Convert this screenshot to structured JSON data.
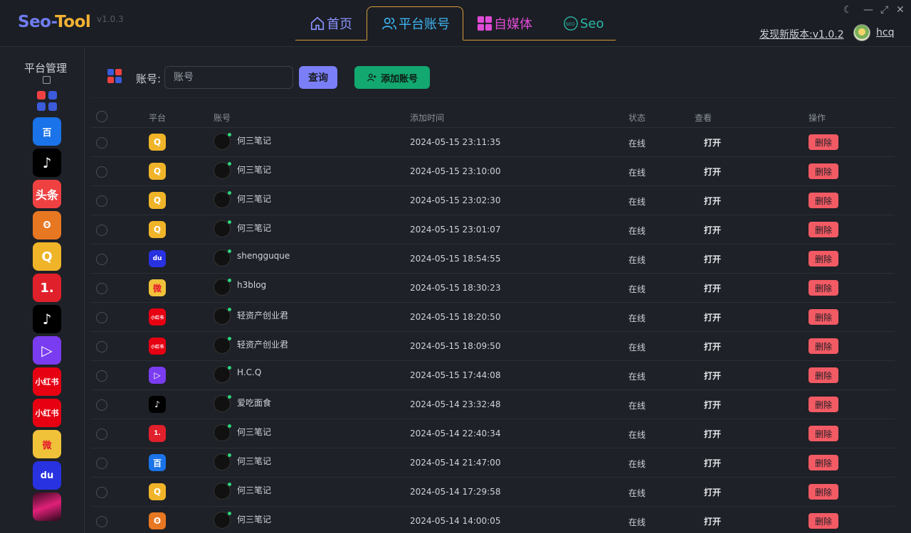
{
  "app": {
    "logo_prefix": "Seo",
    "logo_dash": "-",
    "logo_suffix": "Tool",
    "version": "v1.0.3",
    "update_text": "发现新版本:v1.0.2",
    "username": "hcq"
  },
  "nav": {
    "tabs": [
      {
        "label": "首页",
        "icon": "home-icon"
      },
      {
        "label": "平台账号",
        "icon": "users-icon"
      },
      {
        "label": "自媒体",
        "icon": "media-icon"
      },
      {
        "label": "Seo",
        "icon": "seo-icon"
      }
    ],
    "active": "平台账号"
  },
  "sidebar": {
    "title": "平台管理",
    "platforms": [
      {
        "name": "all",
        "color": "#3b5bdb"
      },
      {
        "name": "baijiahao",
        "color": "#1a73e8",
        "glyph": "百"
      },
      {
        "name": "douyin",
        "color": "#000000",
        "glyph": "♪"
      },
      {
        "name": "toutiao",
        "color": "#f04142",
        "glyph": "头条"
      },
      {
        "name": "sohu",
        "color": "#e87722",
        "glyph": "ʘ"
      },
      {
        "name": "qq",
        "color": "#f0b429",
        "glyph": "Q"
      },
      {
        "name": "yidian",
        "color": "#e0202b",
        "glyph": "1."
      },
      {
        "name": "douyin2",
        "color": "#000000",
        "glyph": "♪"
      },
      {
        "name": "xigua",
        "color": "#7a3cf0",
        "glyph": "▷"
      },
      {
        "name": "xiaohongshu",
        "color": "#e60012",
        "glyph": "小红书"
      },
      {
        "name": "xiaohongshu2",
        "color": "#e60012",
        "glyph": "小红书"
      },
      {
        "name": "weibo",
        "color": "#f0c23a",
        "glyph": "微"
      },
      {
        "name": "baidu",
        "color": "#2932e1",
        "glyph": "du"
      },
      {
        "name": "other",
        "color": "#c2185b",
        "glyph": ""
      }
    ]
  },
  "toolbar": {
    "account_label": "账号:",
    "account_placeholder": "账号",
    "query_label": "查询",
    "add_label": "添加账号"
  },
  "table": {
    "headers": {
      "platform": "平台",
      "account": "账号",
      "added_time": "添加时间",
      "status": "状态",
      "view": "查看",
      "action": "操作"
    },
    "open_label": "打开",
    "delete_label": "删除",
    "rows": [
      {
        "platform": "qq",
        "platform_color": "#f0b429",
        "glyph": "Q",
        "account": "何三笔记",
        "time": "2024-05-15 23:11:35",
        "status": "在线"
      },
      {
        "platform": "qq",
        "platform_color": "#f0b429",
        "glyph": "Q",
        "account": "何三笔记",
        "time": "2024-05-15 23:10:00",
        "status": "在线"
      },
      {
        "platform": "qq",
        "platform_color": "#f0b429",
        "glyph": "Q",
        "account": "何三笔记",
        "time": "2024-05-15 23:02:30",
        "status": "在线"
      },
      {
        "platform": "qq",
        "platform_color": "#f0b429",
        "glyph": "Q",
        "account": "何三笔记",
        "time": "2024-05-15 23:01:07",
        "status": "在线"
      },
      {
        "platform": "baidu",
        "platform_color": "#2932e1",
        "glyph": "du",
        "account": "shengguque",
        "time": "2024-05-15 18:54:55",
        "status": "在线"
      },
      {
        "platform": "weibo",
        "platform_color": "#f0c23a",
        "glyph": "微",
        "account": "h3blog",
        "time": "2024-05-15 18:30:23",
        "status": "在线"
      },
      {
        "platform": "xiaohongshu",
        "platform_color": "#e60012",
        "glyph": "小红书",
        "account": "轻资产创业君",
        "time": "2024-05-15 18:20:50",
        "status": "在线"
      },
      {
        "platform": "xiaohongshu",
        "platform_color": "#e60012",
        "glyph": "小红书",
        "account": "轻资产创业君",
        "time": "2024-05-15 18:09:50",
        "status": "在线"
      },
      {
        "platform": "xigua",
        "platform_color": "#7a3cf0",
        "glyph": "▷",
        "account": "H.C.Q",
        "time": "2024-05-15 17:44:08",
        "status": "在线"
      },
      {
        "platform": "douyin",
        "platform_color": "#000000",
        "glyph": "♪",
        "account": "爱吃面食",
        "time": "2024-05-14 23:32:48",
        "status": "在线"
      },
      {
        "platform": "yidian",
        "platform_color": "#e0202b",
        "glyph": "1.",
        "account": "何三笔记",
        "time": "2024-05-14 22:40:34",
        "status": "在线"
      },
      {
        "platform": "baijiahao",
        "platform_color": "#1a73e8",
        "glyph": "百",
        "account": "何三笔记",
        "time": "2024-05-14 21:47:00",
        "status": "在线"
      },
      {
        "platform": "qq",
        "platform_color": "#f0b429",
        "glyph": "Q",
        "account": "何三笔记",
        "time": "2024-05-14 17:29:58",
        "status": "在线"
      },
      {
        "platform": "sohu",
        "platform_color": "#e87722",
        "glyph": "ʘ",
        "account": "何三笔记",
        "time": "2024-05-14 14:00:05",
        "status": "在线"
      }
    ]
  }
}
